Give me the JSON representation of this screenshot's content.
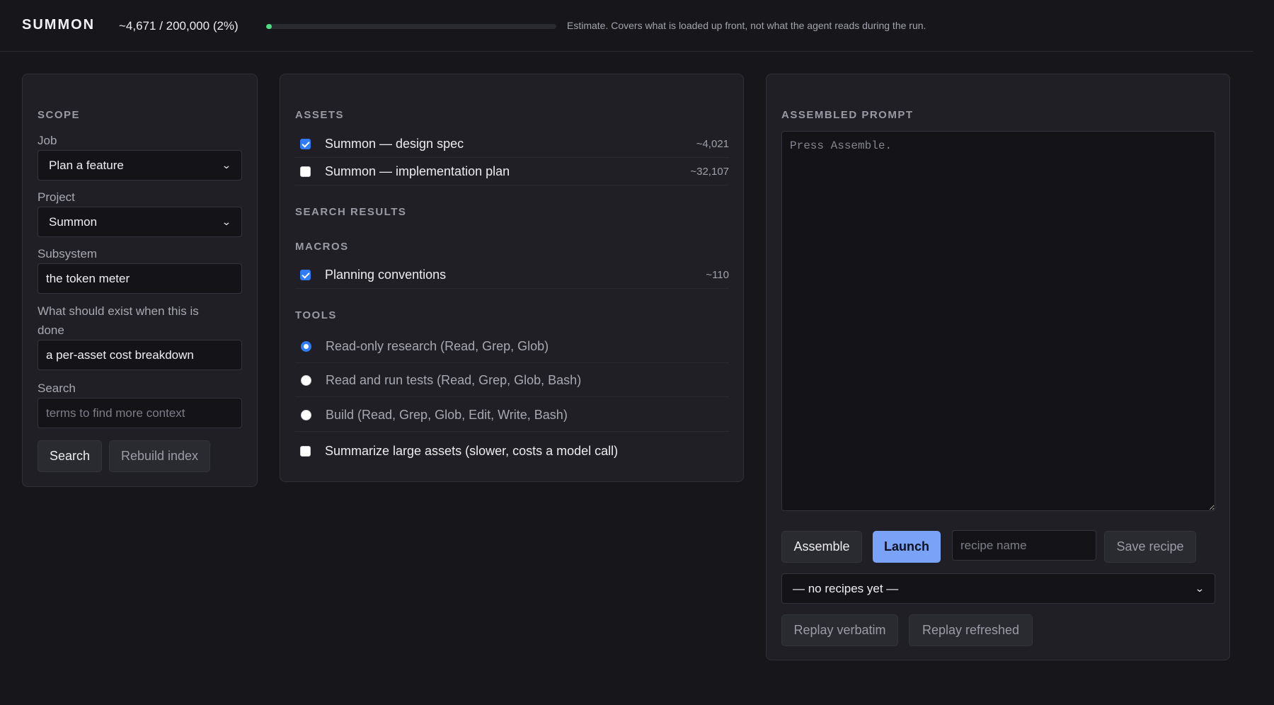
{
  "app": {
    "title": "SUMMON",
    "meter_text": "~4,671 / 200,000 (2%)",
    "meter_fraction": 0.02,
    "meter_note": "Estimate. Covers what is loaded up front, not what the agent reads during the run."
  },
  "scope": {
    "heading": "SCOPE",
    "job_label": "Job",
    "job_value": "Plan a feature",
    "project_label": "Project",
    "project_value": "Summon",
    "subsystem_label": "Subsystem",
    "subsystem_value": "the token meter",
    "done_label": "What should exist when this is done",
    "done_value": "a per-asset cost breakdown",
    "search_label": "Search",
    "search_placeholder": "terms to find more context",
    "search_button": "Search",
    "rebuild_button": "Rebuild index"
  },
  "assets": {
    "heading": "ASSETS",
    "items": [
      {
        "label": "Summon — design spec",
        "tokens": "~4,021",
        "checked": true
      },
      {
        "label": "Summon — implementation plan",
        "tokens": "~32,107",
        "checked": false
      }
    ],
    "search_results_heading": "SEARCH RESULTS",
    "macros_heading": "MACROS",
    "macros": [
      {
        "label": "Planning conventions",
        "tokens": "~110",
        "checked": true
      }
    ],
    "tools_heading": "TOOLS",
    "tools": [
      {
        "label": "Read-only research (Read, Grep, Glob)",
        "selected": true
      },
      {
        "label": "Read and run tests (Read, Grep, Glob, Bash)",
        "selected": false
      },
      {
        "label": "Build (Read, Grep, Glob, Edit, Write, Bash)",
        "selected": false
      }
    ],
    "summarize_label": "Summarize large assets (slower, costs a model call)",
    "summarize_checked": false
  },
  "prompt": {
    "heading": "ASSEMBLED PROMPT",
    "placeholder": "Press Assemble.",
    "assemble_button": "Assemble",
    "launch_button": "Launch",
    "recipe_placeholder": "recipe name",
    "save_recipe_button": "Save recipe",
    "recipes_value": "— no recipes yet —",
    "replay_verbatim_button": "Replay verbatim",
    "replay_refreshed_button": "Replay refreshed"
  },
  "colors": {
    "background": "#16161b",
    "panel": "#1f1f25",
    "accent": "#7aa2f7",
    "meter": "#4ade80",
    "checkbox": "#2f7cf6"
  }
}
